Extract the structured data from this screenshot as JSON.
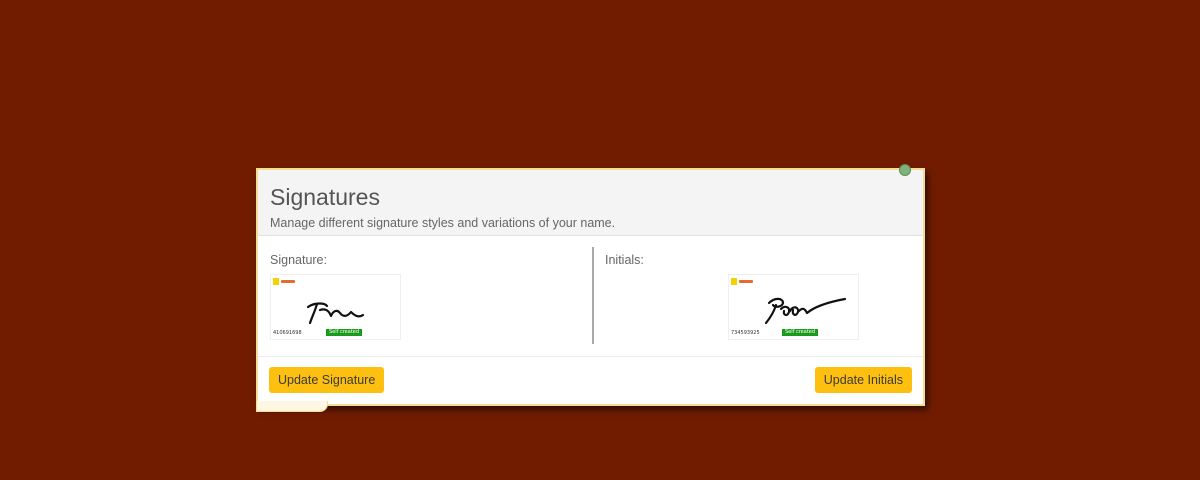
{
  "modal": {
    "title": "Signatures",
    "subtitle": "Manage different signature styles and variations of your name."
  },
  "signature": {
    "label": "Signature:",
    "code": "410691698",
    "badge": "Self created",
    "button": "Update Signature"
  },
  "initials": {
    "label": "Initials:",
    "code": "734593925",
    "badge": "Self created",
    "button": "Update Initials"
  },
  "colors": {
    "background": "#711c00",
    "accent_button": "#fdc010",
    "badge": "#1a9b1a",
    "modal_border": "#f3dc94"
  },
  "icons": {
    "close": "close-icon",
    "logo": "signer-logo-icon"
  }
}
